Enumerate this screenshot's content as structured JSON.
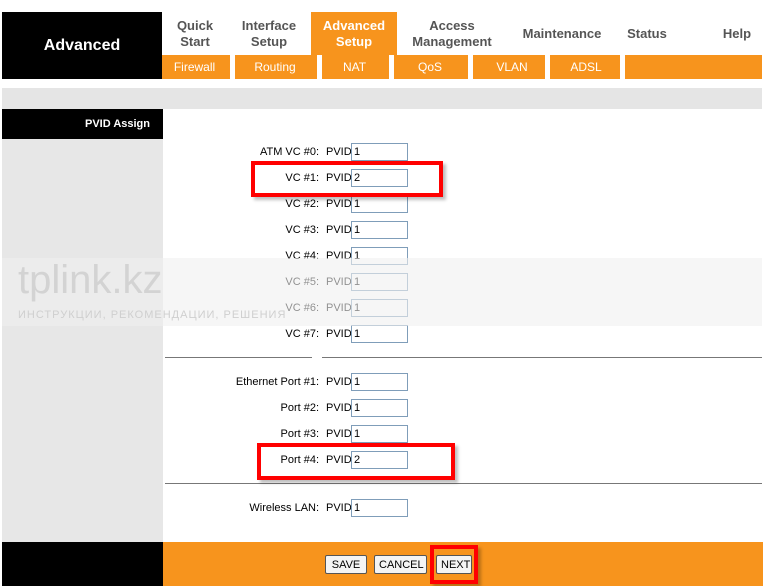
{
  "brand": "Advanced",
  "tabs": [
    {
      "label": "Quick\nStart"
    },
    {
      "label": "Interface\nSetup"
    },
    {
      "label": "Advanced\nSetup"
    },
    {
      "label": "Access\nManagement"
    },
    {
      "label": "Maintenance"
    },
    {
      "label": "Status"
    },
    {
      "label": "Help"
    }
  ],
  "subnav": [
    "Firewall",
    "Routing",
    "NAT",
    "QoS",
    "VLAN",
    "ADSL"
  ],
  "section_title": "PVID Assign",
  "pvid_label": "PVID",
  "atm_rows": [
    {
      "label": "ATM VC #0",
      "value": "1"
    },
    {
      "label": "VC #1",
      "value": "2"
    },
    {
      "label": "VC #2",
      "value": "1"
    },
    {
      "label": "VC #3",
      "value": "1"
    },
    {
      "label": "VC #4",
      "value": "1"
    },
    {
      "label": "VC #5",
      "value": "1"
    },
    {
      "label": "VC #6",
      "value": "1"
    },
    {
      "label": "VC #7",
      "value": "1"
    }
  ],
  "eth_rows": [
    {
      "label": "Ethernet Port #1",
      "value": "1"
    },
    {
      "label": "Port #2",
      "value": "1"
    },
    {
      "label": "Port #3",
      "value": "1"
    },
    {
      "label": "Port #4",
      "value": "2"
    }
  ],
  "wlan_row": {
    "label": "Wireless LAN",
    "value": "1"
  },
  "watermark": {
    "title": "tplink.kz",
    "subtitle": "ИНСТРУКЦИИ, РЕКОМЕНДАЦИИ, РЕШЕНИЯ"
  },
  "buttons": {
    "save": "SAVE",
    "cancel": "CANCEL",
    "next": "NEXT"
  },
  "colors": {
    "accent": "#f7941d",
    "highlight": "#ff0000"
  }
}
